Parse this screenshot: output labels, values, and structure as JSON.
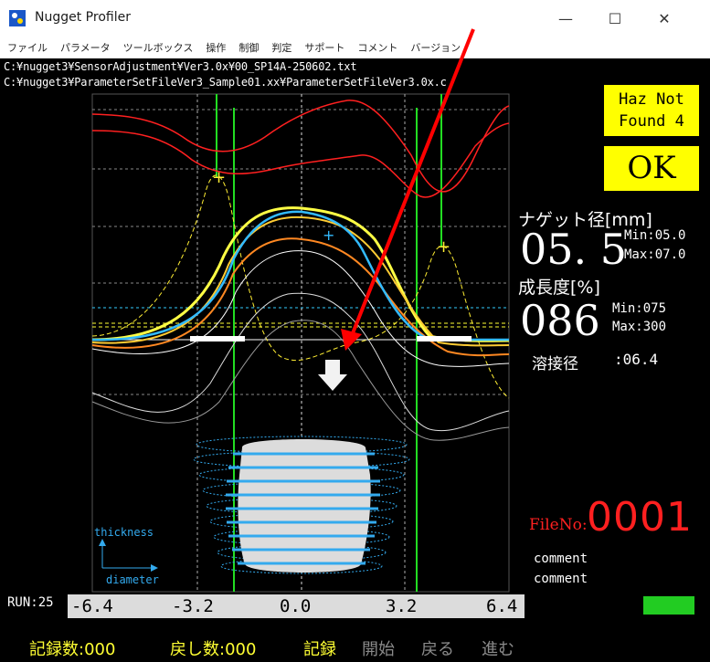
{
  "window": {
    "title": "Nugget Profiler",
    "minimize": "—",
    "maximize": "☐",
    "close": "✕"
  },
  "menu": [
    "ファイル",
    "パラメータ",
    "ツールボックス",
    "操作",
    "制御",
    "判定",
    "サポート",
    "コメント",
    "バージョン"
  ],
  "paths": [
    "C:¥nugget3¥SensorAdjustment¥Ver3.0x¥00_SP14A-250602.txt",
    "C:¥nugget3¥ParameterSetFileVer3_Sample01.xx¥ParameterSetFileVer3.0x.c"
  ],
  "status": {
    "haz_line1": "Haz Not",
    "haz_line2": "Found 4",
    "result": "OK"
  },
  "nugget": {
    "label": "ナゲット径[mm]",
    "value": "05. 5",
    "min": "Min:05.0",
    "max": "Max:07.0"
  },
  "growth": {
    "label": "成長度[%]",
    "value": "086",
    "min": "Min:075",
    "max": "Max:300"
  },
  "weld": {
    "label": "溶接径",
    "value": ":06.4"
  },
  "file": {
    "label": "FileNo:",
    "number": "0001"
  },
  "comments": [
    "comment",
    "comment"
  ],
  "run_label": "RUN:25",
  "axis_ticks": [
    "-6.4",
    "-3.2",
    "0.0",
    "3.2",
    "6.4"
  ],
  "legend": {
    "thickness": "thickness",
    "diameter": "diameter"
  },
  "bottom": {
    "record_count": "記録数:000",
    "return_count": "戻し数:000",
    "record": "記録",
    "start": "開始",
    "back": "戻る",
    "forward": "進む"
  },
  "colors": {
    "badge": "#ffff00",
    "file_number": "#ff2020",
    "status_indicator": "#22cc22",
    "active_text": "#ffff33",
    "disabled_text": "#8a8a8a"
  }
}
